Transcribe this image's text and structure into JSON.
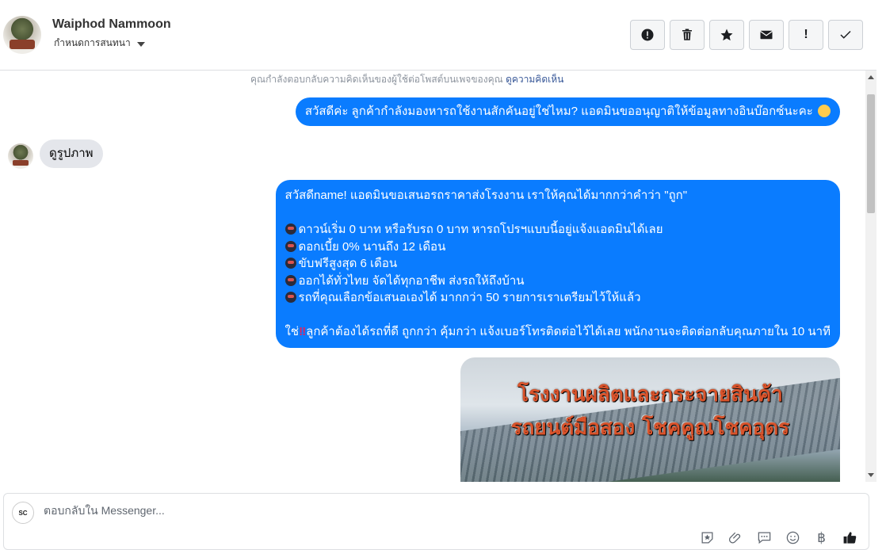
{
  "header": {
    "user_name": "Waiphod Nammoon",
    "status_label": "กำหนดการสนทนา",
    "actions": [
      {
        "icon": "alert-circle-icon",
        "label": "Spam"
      },
      {
        "icon": "trash-icon",
        "label": "Delete"
      },
      {
        "icon": "star-icon",
        "label": "Star"
      },
      {
        "icon": "mail-icon",
        "label": "Mark unread"
      },
      {
        "icon": "exclamation-icon",
        "label": "Important",
        "glyph": "!"
      },
      {
        "icon": "check-icon",
        "label": "Done"
      }
    ]
  },
  "chat": {
    "notice_text": "คุณกำลังตอบกลับความคิดเห็นของผู้ใช้ต่อโพสต์บนเพจของคุณ",
    "notice_link": "ดูความคิดเห็น",
    "messages": [
      {
        "from": "page",
        "text": "สวัสดีค่ะ ลูกค้ากำลังมองหารถใช้งานสักคันอยู่ใช่ไหม? แอดมินขออนุญาติให้ข้อมูลทางอินบ๊อกซ์นะคะ"
      },
      {
        "from": "user",
        "text": "ดูรูปภาพ"
      },
      {
        "from": "page",
        "lines": [
          "สวัสดีname! แอดมินขอเสนอรถราคาส่งโรงงาน เราให้คุณได้มากกว่าคำว่า \"ถูก\"",
          "",
          "ดาวน์เริ่ม 0 บาท หรือรับรถ 0 บาท หารถโปรฯแบบนี้อยู่แจ้งแอดมินได้เลย",
          "ดอกเบี้ย 0% นานถึง 12 เดือน",
          "ขับฟรีสูงสุด 6 เดือน",
          "ออกได้ทั่วไทย จัดได้ทุกอาชีพ ส่งรถให้ถึงบ้าน",
          "รถที่คุณเลือกข้อเสนอเองได้ มากกว่า 50 รายการเราเตรียมไว้ให้แล้ว",
          "",
          "ใช่",
          "ลูกค้าต้องได้รถที่ดี ถูกกว่า คุ้มกว่า แจ้งเบอร์โทรติดต่อไว้ได้เลย พนักงานจะติดต่อกลับคุณภายใน 10 นาที"
        ]
      },
      {
        "from": "page",
        "type": "image",
        "caption_line1": "โรงงานผลิตและกระจายสินค้า",
        "caption_line2": "รถยนต์มือสอง โชคคูณโชคอุดร"
      }
    ]
  },
  "composer": {
    "placeholder": "ตอบกลับใน Messenger...",
    "avatar_text": "SC",
    "tools": [
      "sticker-icon",
      "attachment-icon",
      "saved-reply-icon",
      "emoji-icon",
      "payment-icon",
      "like-icon"
    ],
    "payment_glyph": "฿"
  },
  "colors": {
    "outgoing_bubble": "#0a7cff",
    "incoming_bubble": "#e4e6eb",
    "image_title": "#d9532b"
  }
}
